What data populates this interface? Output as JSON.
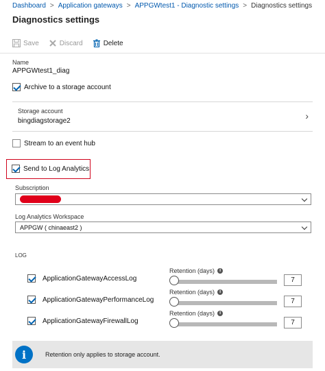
{
  "breadcrumb": {
    "items": [
      "Dashboard",
      "Application gateways",
      "APPGWtest1 - Diagnostic settings",
      "Diagnostics settings"
    ],
    "separator": ">"
  },
  "page_title": "Diagnostics settings",
  "toolbar": {
    "save_label": "Save",
    "discard_label": "Discard",
    "delete_label": "Delete"
  },
  "name_field": {
    "label": "Name",
    "value": "APPGWtest1_diag"
  },
  "archive_storage": {
    "label": "Archive to a storage account",
    "checked": true
  },
  "storage_account": {
    "label": "Storage account",
    "value": "bingdiagstorage2"
  },
  "event_hub": {
    "label": "Stream to an event hub",
    "checked": false
  },
  "log_analytics": {
    "label": "Send to Log Analytics",
    "checked": true
  },
  "subscription": {
    "label": "Subscription"
  },
  "workspace": {
    "label": "Log Analytics Workspace",
    "value": "APPGW ( chinaeast2 )"
  },
  "log_section_label": "LOG",
  "logs": [
    {
      "name": "ApplicationGatewayAccessLog",
      "checked": true,
      "retention_label": "Retention (days)",
      "retention_days": 7
    },
    {
      "name": "ApplicationGatewayPerformanceLog",
      "checked": true,
      "retention_label": "Retention (days)",
      "retention_days": 7
    },
    {
      "name": "ApplicationGatewayFirewallLog",
      "checked": true,
      "retention_label": "Retention (days)",
      "retention_days": 7
    }
  ],
  "info": {
    "message": "Retention only applies to storage account."
  },
  "colors": {
    "accent": "#0063b1",
    "link": "#0058ad",
    "highlight": "#d0021b",
    "info_icon": "#0072c6"
  }
}
